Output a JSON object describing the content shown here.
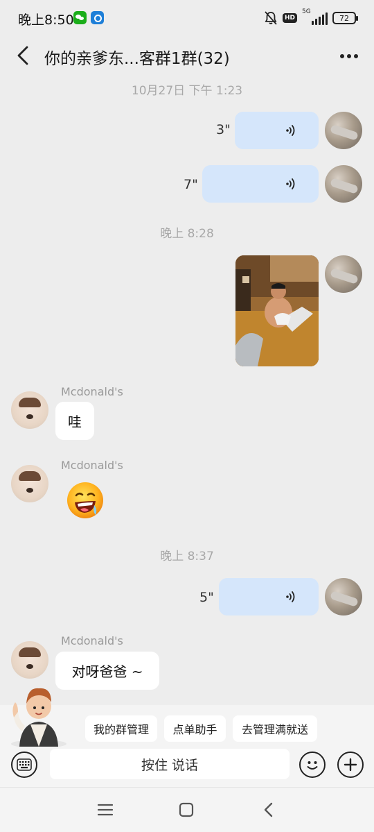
{
  "status_bar": {
    "time": "晚上8:50",
    "battery": "72",
    "network": "5G",
    "icons": [
      "wechat-icon",
      "hub-icon",
      "mute-bell-icon",
      "hd-badge-icon",
      "signal-icon",
      "battery-icon"
    ]
  },
  "header": {
    "title": "你的亲爹东...客群1群(32)",
    "back_icon": "chevron-left-icon",
    "more_icon": "more-dots-icon"
  },
  "messages": {
    "ts1": "10月27日 下午 1:23",
    "voice1_duration": "3\"",
    "voice2_duration": "7\"",
    "ts2": "晚上 8:28",
    "sender1": "Mcdonald's",
    "text1": "哇",
    "sender2": "Mcdonald's",
    "emoji_sticker": "drooling-face-emoji",
    "ts3": "晚上 8:37",
    "voice3_duration": "5\"",
    "sender3": "Mcdonald's",
    "text3": "对呀爸爸 ~"
  },
  "quick_actions": [
    "我的群管理",
    "点单助手",
    "去管理满就送"
  ],
  "input": {
    "hold_to_talk": "按住 说话",
    "left_icon": "keyboard-icon",
    "emoji_icon": "smiley-icon",
    "plus_icon": "plus-icon"
  },
  "system_nav": [
    "menu-icon",
    "home-icon",
    "back-icon"
  ],
  "colors": {
    "background": "#ededed",
    "self_bubble": "#d5e6fb",
    "other_bubble": "#ffffff",
    "timestamp": "#a8a8a8"
  }
}
